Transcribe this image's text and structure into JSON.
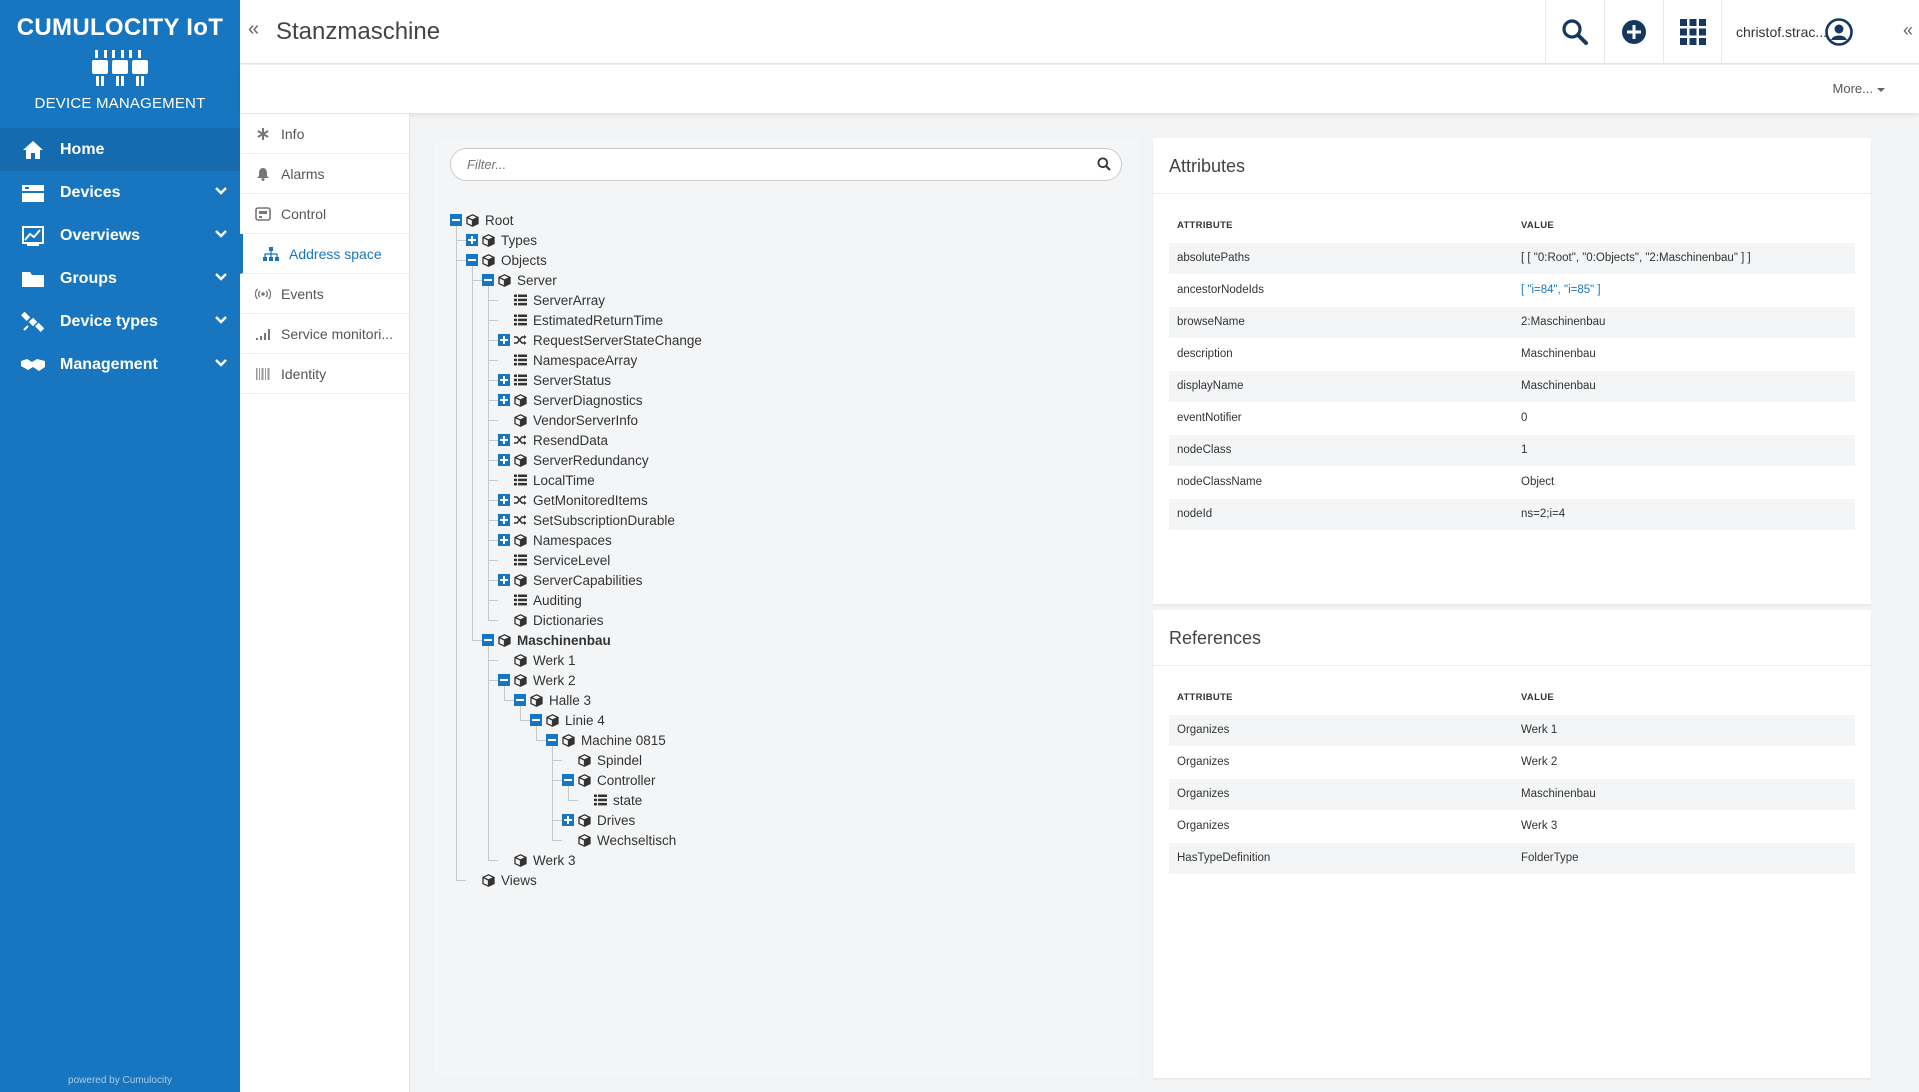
{
  "brand": {
    "title": "CUMULOCITY IoT",
    "subtitle": "DEVICE MANAGEMENT",
    "powered": "powered by Cumulocity"
  },
  "nav": {
    "home": "Home",
    "devices": "Devices",
    "overviews": "Overviews",
    "groups": "Groups",
    "device_types": "Device types",
    "management": "Management"
  },
  "header": {
    "title": "Stanzmaschine",
    "user": "christof.strac..."
  },
  "actionbar": {
    "more": "More..."
  },
  "tabs": {
    "info": "Info",
    "alarms": "Alarms",
    "control": "Control",
    "address_space": "Address space",
    "events": "Events",
    "service_monitoring": "Service monitori...",
    "identity": "Identity"
  },
  "filter": {
    "placeholder": "Filter..."
  },
  "tree": {
    "root": "Root",
    "types": "Types",
    "objects": "Objects",
    "server": "Server",
    "server_array": "ServerArray",
    "estimated_return_time": "EstimatedReturnTime",
    "request_server_state_change": "RequestServerStateChange",
    "namespace_array": "NamespaceArray",
    "server_status": "ServerStatus",
    "server_diagnostics": "ServerDiagnostics",
    "vendor_server_info": "VendorServerInfo",
    "resend_data": "ResendData",
    "server_redundancy": "ServerRedundancy",
    "local_time": "LocalTime",
    "get_monitored_items": "GetMonitoredItems",
    "set_subscription_durable": "SetSubscriptionDurable",
    "namespaces": "Namespaces",
    "service_level": "ServiceLevel",
    "server_capabilities": "ServerCapabilities",
    "auditing": "Auditing",
    "dictionaries": "Dictionaries",
    "maschinenbau": "Maschinenbau",
    "werk1": "Werk 1",
    "werk2": "Werk 2",
    "halle3": "Halle 3",
    "linie4": "Linie 4",
    "machine0815": "Machine 0815",
    "spindel": "Spindel",
    "controller": "Controller",
    "state": "state",
    "drives": "Drives",
    "wechseltisch": "Wechseltisch",
    "werk3": "Werk 3",
    "views": "Views"
  },
  "attributes": {
    "title": "Attributes",
    "col_attr": "ATTRIBUTE",
    "col_value": "VALUE",
    "rows": [
      {
        "k": "absolutePaths",
        "v": "[ [ \"0:Root\", \"0:Objects\", \"2:Maschinenbau\" ] ]"
      },
      {
        "k": "ancestorNodeIds",
        "v": "[ \"i=84\", \"i=85\" ]"
      },
      {
        "k": "browseName",
        "v": "2:Maschinenbau"
      },
      {
        "k": "description",
        "v": "Maschinenbau"
      },
      {
        "k": "displayName",
        "v": "Maschinenbau"
      },
      {
        "k": "eventNotifier",
        "v": "0"
      },
      {
        "k": "nodeClass",
        "v": "1"
      },
      {
        "k": "nodeClassName",
        "v": "Object"
      },
      {
        "k": "nodeId",
        "v": "ns=2;i=4"
      }
    ]
  },
  "references": {
    "title": "References",
    "col_attr": "ATTRIBUTE",
    "col_value": "VALUE",
    "rows": [
      {
        "k": "Organizes",
        "v": "Werk 1"
      },
      {
        "k": "Organizes",
        "v": "Werk 2"
      },
      {
        "k": "Organizes",
        "v": "Maschinenbau"
      },
      {
        "k": "Organizes",
        "v": "Werk 3"
      },
      {
        "k": "HasTypeDefinition",
        "v": "FolderType"
      }
    ]
  },
  "colors": {
    "brand": "#1776bf",
    "nav_bg": "#1776bf",
    "link": "#1776bf"
  }
}
